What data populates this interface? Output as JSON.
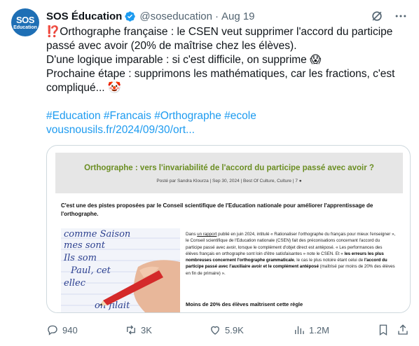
{
  "account": {
    "avatar_line1": "SOS",
    "avatar_line2": "Education",
    "name": "SOS Éducation",
    "handle": "@soseducation",
    "separator": "·",
    "date": "Aug 19"
  },
  "tweet": {
    "line1": "⁉️Orthographe française : le CSEN veut supprimer l'accord du participe passé avec avoir (20% de maîtrise chez les élèves).",
    "line2": "D'une logique imparable : si c'est difficile, on supprime 😱",
    "line3": "Prochaine étape : supprimons les mathématiques, car les fractions, c'est compliqué... 🤡",
    "hashtags": "#Education #Francais #Orthographe #ecole",
    "link": "vousnousils.fr/2024/09/30/ort..."
  },
  "card": {
    "title": "Orthographe : vers l'invariabilité de l'accord du participe passé avec avoir ?",
    "meta": "Posté par Sandra Klourza | Sep 30, 2024 | Best Of Culture, Culture | 7 ●",
    "lead": "C'est une des pistes proposées par le Conseil scientifique de l'Education nationale pour améliorer l'apprentissage de l'orthographe.",
    "body_prefix": "Dans ",
    "body_link": "un rapport",
    "body_1": " publié en juin 2024, intitulé « Rationaliser l'orthographe du français pour mieux l'enseigner », le Conseil scientifique de l'Education nationale (CSEN) fait des préconisations concernant l'accord du participe passé avec avoir, lorsque le complément d'objet direct est antéposé. « Les performances des élèves français en orthographe sont loin d'être satisfaisantes » note le CSEN. Et « ",
    "body_bold1": "les erreurs les plus nombreuses concernent l'orthographe grammaticale",
    "body_2": ", le cas le plus notoire étant celui de ",
    "body_bold2": "l'accord du participe passé avec l'auxiliaire avoir et le complément antéposé",
    "body_3": " (maîtrisé par moins de 20% des élèves en fin de primaire) ».",
    "subheading": "Moins de 20% des élèves maîtrisent cette règle",
    "handwriting": [
      "comme Saison",
      "mes sont",
      "Ils som",
      "Paul, cet",
      "ellec",
      "on filait"
    ]
  },
  "actions": {
    "replies": "940",
    "reposts": "3K",
    "likes": "5.9K",
    "views": "1.2M"
  },
  "colors": {
    "accent": "#1d9bf0",
    "muted": "#536471",
    "card_title": "#6b8e23",
    "avatar": "#1e6fb5"
  }
}
